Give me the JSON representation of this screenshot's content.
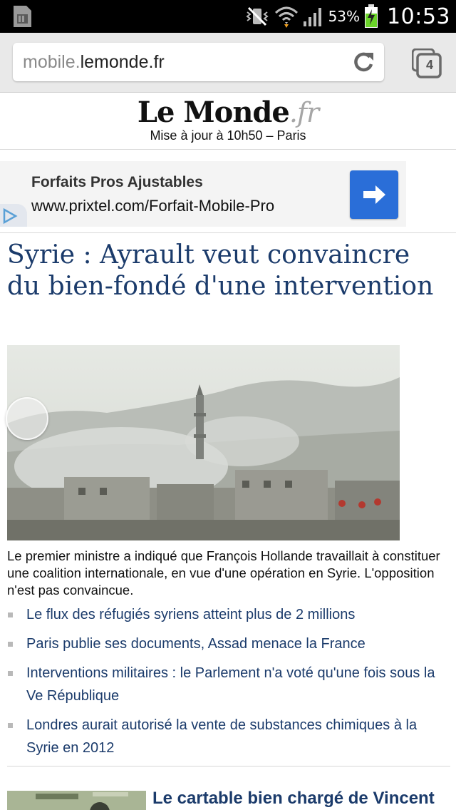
{
  "status_bar": {
    "battery_percent": "53%",
    "time": "10:53",
    "icons": [
      "sim-card-icon",
      "mute-vibrate-icon",
      "wifi-icon",
      "signal-icon",
      "battery-charging-icon"
    ]
  },
  "browser": {
    "url_subdomain": "mobile.",
    "url_domain": "lemonde.fr",
    "tab_count": "4",
    "icons": [
      "reload-icon",
      "tabs-icon"
    ]
  },
  "masthead": {
    "logo_main": "Le Monde",
    "logo_suffix": ".fr",
    "update_text": "Mise à jour à 10h50 – Paris"
  },
  "ad": {
    "title": "Forfaits Pros Ajustables",
    "url": "www.prixtel.com/Forfait-Mobile-Pro",
    "icons": [
      "arrow-right-icon",
      "adchoices-icon"
    ]
  },
  "article": {
    "headline": "Syrie : Ayrault veut convaincre du bien-fondé d'une intervention",
    "summary": "Le premier ministre a indiqué que François Hollande travaillait à constituer une coalition internationale, en vue d'une opération en Syrie. L'opposition n'est pas convaincue.",
    "related": [
      "Le flux des réfugiés syriens atteint plus de 2 millions",
      "Paris publie ses documents, Assad menace la France",
      "Interventions militaires : le Parlement n'a voté qu'une fois sous la Ve République",
      "Londres aurait autorisé la vente de substances chimiques à la Syrie en 2012"
    ]
  },
  "next_article": {
    "title": "Le cartable bien chargé de Vincent"
  },
  "colors": {
    "headline": "#1b3b6b",
    "ad_button": "#2a6ed8",
    "status_bar": "#000000",
    "battery_charge": "#6bd42a"
  }
}
